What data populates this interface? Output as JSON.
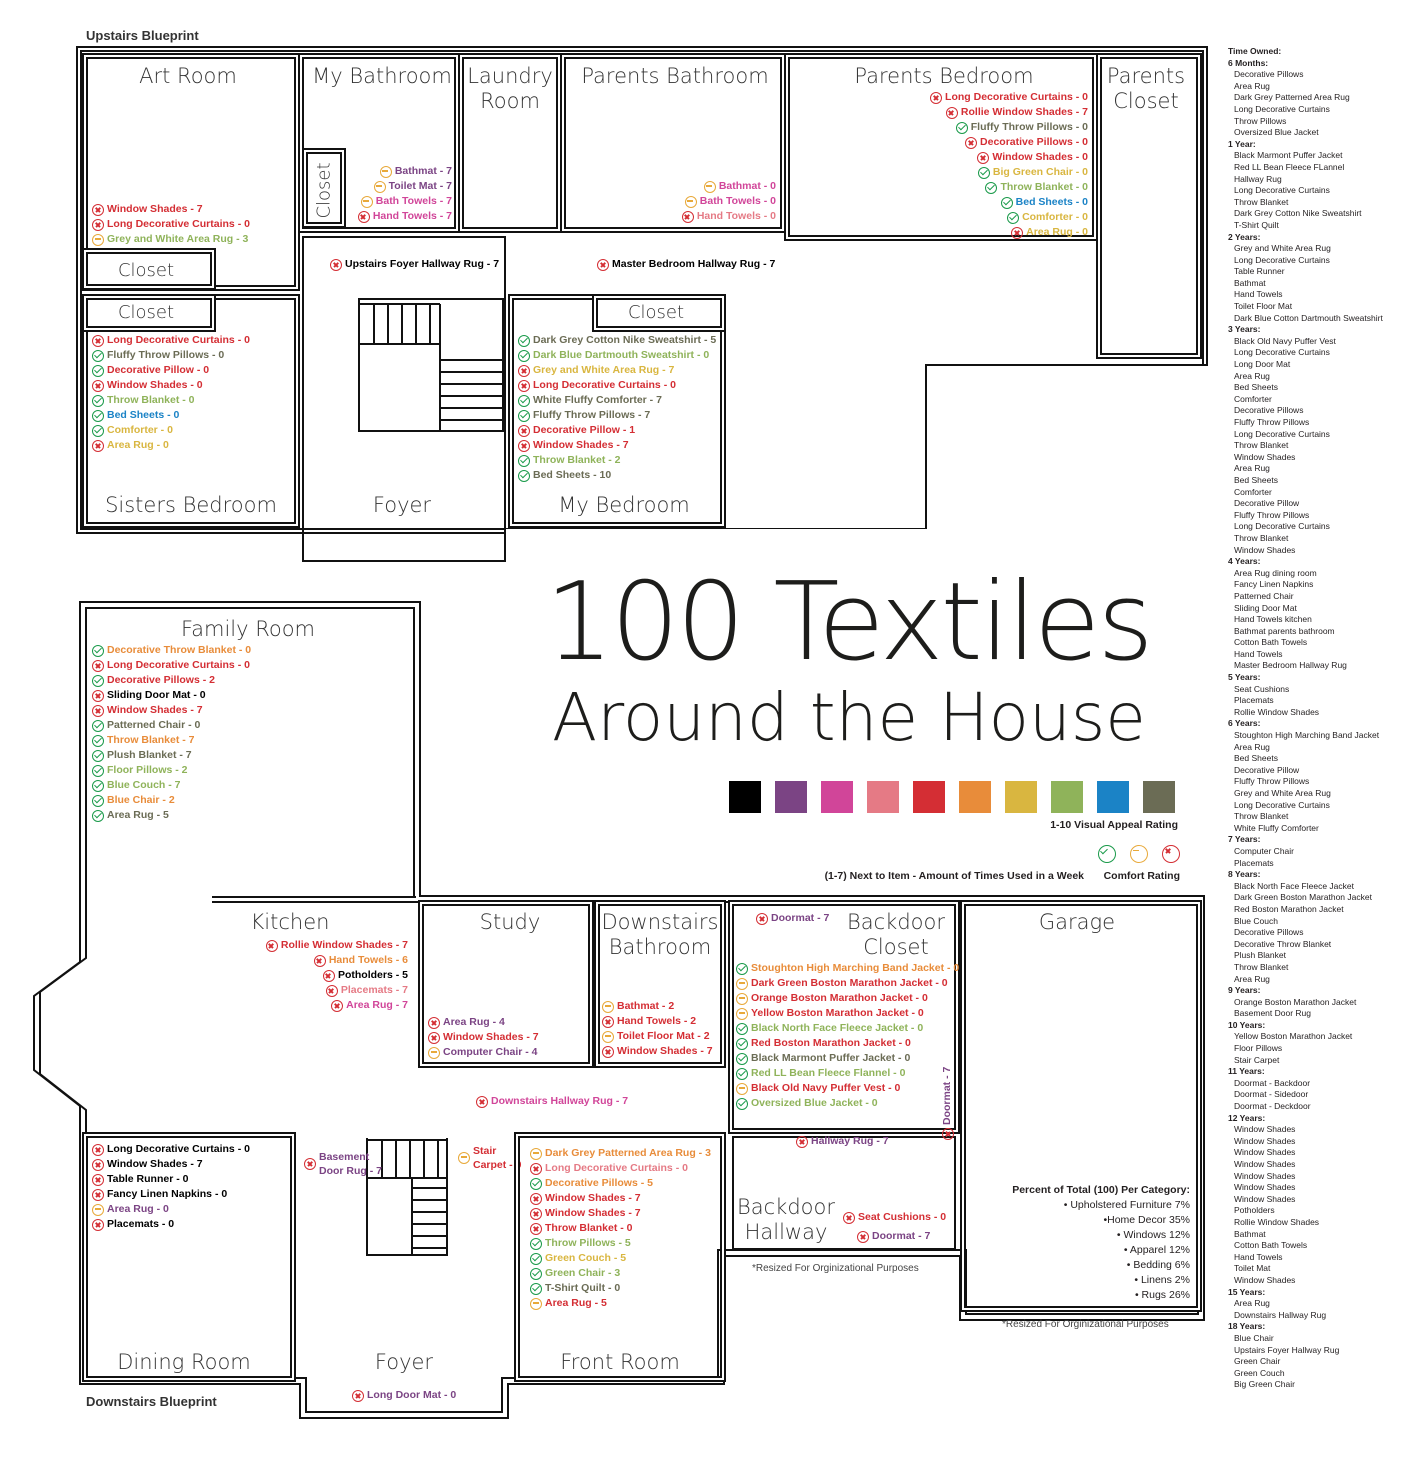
{
  "blueprints": {
    "upstairs": "Upstairs Blueprint",
    "downstairs": "Downstairs Blueprint"
  },
  "title": {
    "line1": "100 Textiles",
    "line2": "Around the House"
  },
  "colors": [
    "#000000",
    "#7b4484",
    "#d14599",
    "#e57a85",
    "#d42e34",
    "#e88c3a",
    "#d9b640",
    "#8fb35a",
    "#1b83c6",
    "#6b6c55"
  ],
  "legend": {
    "visual": "1-10 Visual Appeal Rating",
    "usage": "(1-7) Next to Item - Amount of Times Used in a Week",
    "comfort": "Comfort Rating"
  },
  "rooms": {
    "art_room": {
      "name": "Art Room",
      "items": [
        [
          "bad",
          "Window Shades - 7",
          "#d42e34"
        ],
        [
          "bad",
          "Long Decorative Curtains - 0",
          "#d42e34"
        ],
        [
          "mid",
          "Grey and White Area Rug - 3",
          "#8fb35a"
        ]
      ]
    },
    "my_bathroom": {
      "name": "My Bathroom",
      "items": [
        [
          "mid",
          "Bathmat - 7",
          "#7b4484"
        ],
        [
          "mid",
          "Toilet Mat - 7",
          "#7b4484"
        ],
        [
          "mid",
          "Bath Towels - 7",
          "#d14599"
        ],
        [
          "bad",
          "Hand Towels - 7",
          "#d14599"
        ]
      ]
    },
    "laundry": {
      "name": "Laundry\nRoom"
    },
    "parents_bathroom": {
      "name": "Parents Bathroom",
      "items": [
        [
          "mid",
          "Bathmat - 0",
          "#d14599"
        ],
        [
          "mid",
          "Bath Towels - 0",
          "#d14599"
        ],
        [
          "bad",
          "Hand Towels - 0",
          "#e57a85"
        ]
      ]
    },
    "parents_bedroom": {
      "name": "Parents Bedroom",
      "items": [
        [
          "bad",
          "Long Decorative Curtains - 0",
          "#d42e34"
        ],
        [
          "bad",
          "Rollie Window Shades - 7",
          "#d42e34"
        ],
        [
          "good",
          "Fluffy Throw Pillows - 0",
          "#6b6c55"
        ],
        [
          "bad",
          "Decorative Pillows - 0",
          "#d42e34"
        ],
        [
          "bad",
          "Window Shades - 0",
          "#d42e34"
        ],
        [
          "good",
          "Big Green Chair - 0",
          "#d9b640"
        ],
        [
          "good",
          "Throw Blanket - 0",
          "#8fb35a"
        ],
        [
          "good",
          "Bed Sheets - 0",
          "#1b83c6"
        ],
        [
          "good",
          "Comforter - 0",
          "#d9b640"
        ],
        [
          "bad",
          "Area Rug - 0",
          "#d9b640"
        ]
      ]
    },
    "parents_closet": {
      "name": "Parents\nCloset"
    },
    "closet": "Closet",
    "upstairs_hall": [
      [
        "bad",
        "Upstairs Foyer Hallway Rug - 7",
        "#000000"
      ],
      [
        "bad",
        "Master Bedroom Hallway Rug - 7",
        "#000000"
      ]
    ],
    "sisters_bedroom": {
      "name": "Sisters Bedroom",
      "items": [
        [
          "bad",
          "Long Decorative Curtains - 0",
          "#d42e34"
        ],
        [
          "good",
          "Fluffy Throw Pillows - 0",
          "#6b6c55"
        ],
        [
          "good",
          "Decorative Pillow - 0",
          "#d42e34"
        ],
        [
          "bad",
          "Window Shades - 0",
          "#d42e34"
        ],
        [
          "good",
          "Throw Blanket - 0",
          "#8fb35a"
        ],
        [
          "good",
          "Bed Sheets - 0",
          "#1b83c6"
        ],
        [
          "good",
          "Comforter - 0",
          "#d9b640"
        ],
        [
          "bad",
          "Area Rug - 0",
          "#d9b640"
        ]
      ]
    },
    "foyer_up": {
      "name": "Foyer"
    },
    "my_bedroom": {
      "name": "My Bedroom",
      "items": [
        [
          "good",
          "Dark Grey Cotton Nike Sweatshirt - 5",
          "#6b6c55"
        ],
        [
          "good",
          "Dark Blue Dartmouth Sweatshirt - 0",
          "#8fb35a"
        ],
        [
          "bad",
          "Grey and White Area Rug - 7",
          "#d9b640"
        ],
        [
          "bad",
          "Long Decorative Curtains - 0",
          "#d42e34"
        ],
        [
          "good",
          "White Fluffy Comforter - 7",
          "#6b6c55"
        ],
        [
          "good",
          "Fluffy Throw Pillows - 7",
          "#6b6c55"
        ],
        [
          "bad",
          "Decorative Pillow - 1",
          "#d42e34"
        ],
        [
          "bad",
          "Window Shades - 7",
          "#d42e34"
        ],
        [
          "good",
          "Throw Blanket - 2",
          "#8fb35a"
        ],
        [
          "good",
          "Bed Sheets - 10",
          "#6b6c55"
        ]
      ]
    },
    "family_room": {
      "name": "Family Room",
      "items": [
        [
          "good",
          "Decorative Throw Blanket - 0",
          "#e88c3a"
        ],
        [
          "bad",
          "Long Decorative Curtains - 0",
          "#d42e34"
        ],
        [
          "good",
          "Decorative Pillows - 2",
          "#d42e34"
        ],
        [
          "bad",
          "Sliding Door Mat - 0",
          "#000000"
        ],
        [
          "bad",
          "Window Shades - 7",
          "#d42e34"
        ],
        [
          "good",
          "Patterned Chair - 0",
          "#6b6c55"
        ],
        [
          "good",
          "Throw Blanket - 7",
          "#e88c3a"
        ],
        [
          "good",
          "Plush Blanket - 7",
          "#6b6c55"
        ],
        [
          "good",
          "Floor Pillows - 2",
          "#8fb35a"
        ],
        [
          "good",
          "Blue Couch - 7",
          "#8fb35a"
        ],
        [
          "good",
          "Blue Chair - 2",
          "#e88c3a"
        ],
        [
          "good",
          "Area Rug - 5",
          "#6b6c55"
        ]
      ]
    },
    "kitchen": {
      "name": "Kitchen",
      "items": [
        [
          "bad",
          "Rollie Window Shades - 7",
          "#d42e34"
        ],
        [
          "bad",
          "Hand Towels - 6",
          "#e88c3a"
        ],
        [
          "bad",
          "Potholders - 5",
          "#000000"
        ],
        [
          "bad",
          "Placemats - 7",
          "#e57a85"
        ],
        [
          "bad",
          "Area Rug - 7",
          "#d14599"
        ]
      ]
    },
    "study": {
      "name": "Study",
      "items": [
        [
          "bad",
          "Area Rug - 4",
          "#7b4484"
        ],
        [
          "bad",
          "Window Shades - 7",
          "#d42e34"
        ],
        [
          "mid",
          "Computer Chair - 4",
          "#7b4484"
        ]
      ]
    },
    "downstairs_bathroom": {
      "name": "Downstairs\nBathroom",
      "items": [
        [
          "mid",
          "Bathmat - 2",
          "#d42e34"
        ],
        [
          "bad",
          "Hand Towels - 2",
          "#d42e34"
        ],
        [
          "mid",
          "Toilet Floor Mat - 2",
          "#d42e34"
        ],
        [
          "bad",
          "Window Shades - 7",
          "#d42e34"
        ]
      ]
    },
    "backdoor_closet": {
      "name": "Backdoor\nCloset",
      "doormat": [
        "bad",
        "Doormat - 7",
        "#7b4484"
      ],
      "items": [
        [
          "good",
          "Stoughton High Marching Band Jacket - 0",
          "#e88c3a"
        ],
        [
          "mid",
          "Dark Green Boston Marathon Jacket - 0",
          "#d42e34"
        ],
        [
          "mid",
          "Orange Boston Marathon Jacket - 0",
          "#d42e34"
        ],
        [
          "mid",
          "Yellow Boston Marathon Jacket - 0",
          "#d42e34"
        ],
        [
          "good",
          "Black North Face Fleece Jacket - 0",
          "#8fb35a"
        ],
        [
          "good",
          "Red Boston Marathon Jacket - 0",
          "#d42e34"
        ],
        [
          "good",
          "Black Marmont Puffer Jacket - 0",
          "#6b6c55"
        ],
        [
          "good",
          "Red LL Bean Fleece Flannel - 0",
          "#8fb35a"
        ],
        [
          "mid",
          "Black Old Navy Puffer Vest - 0",
          "#d42e34"
        ],
        [
          "good",
          "Oversized Blue Jacket - 0",
          "#8fb35a"
        ]
      ]
    },
    "garage": {
      "name": "Garage"
    },
    "downstairs_hall": [
      "bad",
      "Downstairs Hallway Rug - 7",
      "#d14599"
    ],
    "backdoor_hallway": {
      "name": "Backdoor\nHallway",
      "items": [
        [
          "bad",
          "Hallway Rug - 7",
          "#7b4484"
        ],
        [
          "bad",
          "Doormat - 7",
          "#7b4484"
        ],
        [
          "bad",
          "Seat Cushions - 0",
          "#d42e34"
        ],
        [
          "bad",
          "Doormat - 7",
          "#7b4484"
        ]
      ]
    },
    "dining_room": {
      "name": "Dining Room",
      "items": [
        [
          "bad",
          "Long Decorative Curtains - 0",
          "#000000"
        ],
        [
          "bad",
          "Window Shades - 7",
          "#000000"
        ],
        [
          "bad",
          "Table Runner - 0",
          "#000000"
        ],
        [
          "bad",
          "Fancy Linen Napkins - 0",
          "#000000"
        ],
        [
          "mid",
          "Area Rug - 0",
          "#7b4484"
        ],
        [
          "bad",
          "Placemats - 0",
          "#000000"
        ]
      ]
    },
    "foyer_down": {
      "name": "Foyer",
      "basement": [
        "bad",
        "Basement\nDoor Rug - 7",
        "#7b4484"
      ],
      "stair": [
        "mid",
        "Stair\nCarpet - 0",
        "#d42e34"
      ],
      "longdoor": [
        "bad",
        "Long Door Mat - 0",
        "#7b4484"
      ]
    },
    "front_room": {
      "name": "Front Room",
      "items": [
        [
          "mid",
          "Dark Grey Patterned Area Rug - 3",
          "#e88c3a"
        ],
        [
          "bad",
          "Long Decorative Curtains - 0",
          "#e57a85"
        ],
        [
          "good",
          "Decorative Pillows - 5",
          "#e88c3a"
        ],
        [
          "bad",
          "Window Shades - 7",
          "#d42e34"
        ],
        [
          "bad",
          "Window Shades - 7",
          "#d42e34"
        ],
        [
          "bad",
          "Throw Blanket - 0",
          "#d42e34"
        ],
        [
          "good",
          "Throw Pillows - 5",
          "#8fb35a"
        ],
        [
          "good",
          "Green Couch - 5",
          "#d9b640"
        ],
        [
          "good",
          "Green Chair - 3",
          "#8fb35a"
        ],
        [
          "good",
          "T-Shirt Quilt - 0",
          "#6b6c55"
        ],
        [
          "mid",
          "Area Rug - 5",
          "#d42e34"
        ]
      ]
    }
  },
  "notes": {
    "resize": "*Resized For Orginizational Purposes"
  },
  "stats": {
    "title": "Percent of Total (100) Per Category:",
    "lines": [
      "• Upholstered Furniture 7%",
      "•Home Decor 35%",
      "• Windows 12%",
      "• Apparel 12%",
      "• Bedding 6%",
      "• Linens 2%",
      "• Rugs 26%"
    ]
  },
  "sidebar": {
    "title": "Time Owned:",
    "groups": [
      [
        "6 Months:",
        [
          "Decorative Pillows",
          "Area Rug",
          "Dark Grey Patterned Area Rug",
          "Long Decorative Curtains",
          "Throw Pillows",
          "Oversized Blue Jacket"
        ]
      ],
      [
        "1 Year:",
        [
          "Black Marmont Puffer Jacket",
          "Red LL Bean Fleece FLannel",
          "Hallway Rug",
          "Long Decorative Curtains",
          "Throw Blanket",
          "Dark Grey Cotton Nike Sweatshirt",
          "T-Shirt Quilt"
        ]
      ],
      [
        "2 Years:",
        [
          "Grey and White Area Rug",
          "Long Decorative Curtains",
          "Table Runner",
          "Bathmat",
          "Hand Towels",
          "Toilet Floor Mat",
          "Dark Blue Cotton Dartmouth Sweatshirt"
        ]
      ],
      [
        "3 Years:",
        [
          "Black Old Navy Puffer Vest",
          "Long Decorative Curtains",
          "Long Door Mat",
          "Area Rug",
          "Bed Sheets",
          "Comforter",
          "Decorative Pillows",
          "Fluffy Throw Pillows",
          "Long Decorative Curtains",
          "Throw Blanket",
          "Window Shades",
          "Area Rug",
          "Bed Sheets",
          "Comforter",
          "Decorative Pillow",
          "Fluffy Throw Pillows",
          "Long Decorative Curtains",
          "Throw Blanket",
          "Window Shades"
        ]
      ],
      [
        "4 Years:",
        [
          "Area Rug dining room",
          "Fancy Linen Napkins",
          "Patterned Chair",
          "Sliding Door Mat",
          "Hand Towels kitchen",
          "Bathmat parents bathroom",
          "Cotton Bath Towels",
          "Hand Towels",
          "Master Bedroom Hallway Rug"
        ]
      ],
      [
        "5 Years:",
        [
          "Seat Cushions",
          "Placemats",
          "Rollie Window Shades"
        ]
      ],
      [
        "6 Years:",
        [
          "Stoughton High Marching Band Jacket",
          "Area Rug",
          "Bed Sheets",
          "Decorative Pillow",
          "Fluffy Throw Pillows",
          "Grey and White Area Rug",
          "Long Decorative Curtains",
          "Throw Blanket",
          "White Fluffy Comforter"
        ]
      ],
      [
        "7 Years:",
        [
          "Computer Chair",
          "Placemats"
        ]
      ],
      [
        "8 Years:",
        [
          "Black North Face Fleece Jacket",
          "Dark Green Boston Marathon Jacket",
          "Red Boston Marathon Jacket",
          "Blue Couch",
          "Decorative Pillows",
          "Decorative Throw Blanket",
          "Plush Blanket",
          "Throw Blanket",
          "Area Rug"
        ]
      ],
      [
        "9 Years:",
        [
          "Orange Boston Marathon Jacket",
          "Basement Door Rug"
        ]
      ],
      [
        "10 Years:",
        [
          "Yellow Boston Marathon Jacket",
          "Floor Pillows",
          "Stair Carpet"
        ]
      ],
      [
        "11 Years:",
        [
          "Doormat - Backdoor",
          "Doormat - Sidedoor",
          "Doormat - Deckdoor"
        ]
      ],
      [
        "12 Years:",
        [
          "Window Shades",
          "Window Shades",
          "Window Shades",
          "Window Shades",
          "Window Shades",
          "Window Shades",
          "Window Shades",
          "Potholders",
          "Rollie Window Shades",
          "Bathmat",
          "Cotton Bath Towels",
          "Hand Towels",
          "Toilet Mat",
          "Window Shades"
        ]
      ],
      [
        "15 Years:",
        [
          "Area Rug",
          "Downstairs Hallway Rug"
        ]
      ],
      [
        "18 Years:",
        [
          "Blue Chair",
          "Upstairs Foyer Hallway Rug",
          "Green Chair",
          "Green Couch",
          "Big Green Chair"
        ]
      ]
    ]
  }
}
